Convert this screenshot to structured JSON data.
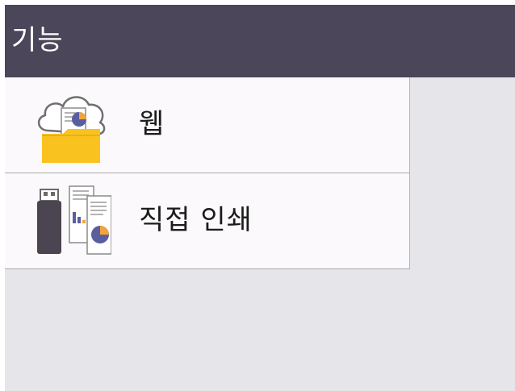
{
  "header": {
    "title": "기능"
  },
  "menu": {
    "items": [
      {
        "label": "웹",
        "icon": "cloud-folder-icon"
      },
      {
        "label": "직접 인쇄",
        "icon": "usb-documents-icon"
      }
    ]
  },
  "colors": {
    "header_bg": "#4b4659",
    "screen_bg": "#e6e6ea",
    "item_bg": "#fbf9fb",
    "folder": "#f9c21f",
    "pie": "#5a5e9e",
    "pie_accent": "#f2a43a"
  }
}
